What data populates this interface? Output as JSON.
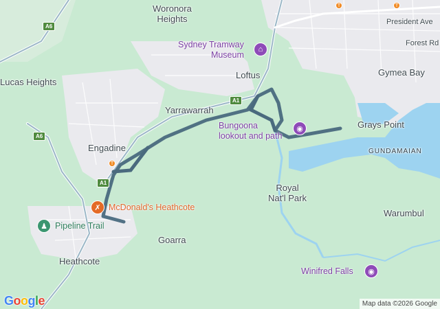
{
  "map": {
    "places": [
      {
        "id": "woronora",
        "text": "Woronora\nHeights"
      },
      {
        "id": "lucas",
        "text": "Lucas Heights"
      },
      {
        "id": "loftus",
        "text": "Loftus"
      },
      {
        "id": "gymea",
        "text": "Gymea Bay"
      },
      {
        "id": "yarrawarrah",
        "text": "Yarrawarrah"
      },
      {
        "id": "graysPoint",
        "text": "Grays Point"
      },
      {
        "id": "gundamaian",
        "text": "GUNDAMAIAN"
      },
      {
        "id": "engadine",
        "text": "Engadine"
      },
      {
        "id": "royal",
        "text": "Royal\nNat'l Park"
      },
      {
        "id": "warumbul",
        "text": "Warumbul"
      },
      {
        "id": "goarra",
        "text": "Goarra"
      },
      {
        "id": "heathcote",
        "text": "Heathcote"
      },
      {
        "id": "presidentAve",
        "text": "President Ave"
      },
      {
        "id": "forestRd",
        "text": "Forest Rd"
      }
    ],
    "pois": [
      {
        "id": "tramway",
        "text": "Sydney Tramway\nMuseum",
        "color": "#8e4bb8",
        "icon": "museum-icon"
      },
      {
        "id": "bungoona",
        "text": "Bungoona\nlookout and path",
        "color": "#8e4bb8",
        "icon": "camera-icon"
      },
      {
        "id": "mcdonalds",
        "text": "McDonald's Heathcote",
        "color": "#e46b26",
        "icon": "restaurant-icon"
      },
      {
        "id": "pipeline",
        "text": "Pipeline Trail",
        "color": "#3b9670",
        "icon": "hiker-icon"
      },
      {
        "id": "winifred",
        "text": "Winifred Falls",
        "color": "#8e4bb8",
        "icon": "camera-icon"
      }
    ],
    "road_shields": [
      "A6",
      "A6",
      "A1",
      "A1"
    ],
    "route": {
      "color": "#4a6a7e"
    },
    "logo_text": "Google",
    "attribution": "Map data ©2026 Google"
  }
}
